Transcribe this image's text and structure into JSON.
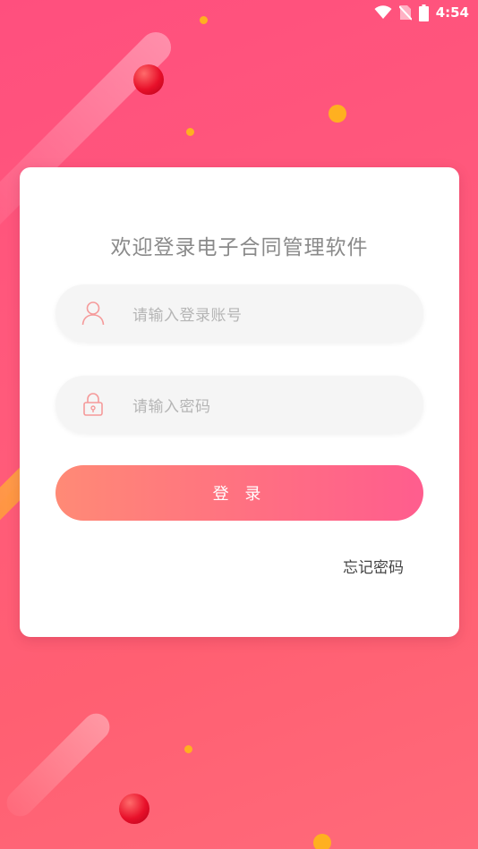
{
  "status_bar": {
    "time": "4:54",
    "icons": [
      "wifi-icon",
      "no-sim-icon",
      "battery-icon"
    ]
  },
  "login": {
    "title": "欢迎登录电子合同管理软件",
    "account_placeholder": "请输入登录账号",
    "password_placeholder": "请输入密码",
    "login_button": "登 录",
    "forgot_password": "忘记密码"
  },
  "colors": {
    "background": "#ff5a7b",
    "button_start": "#ff8a76",
    "button_end": "#ff5d8e",
    "icon_accent": "#f59a9a"
  }
}
